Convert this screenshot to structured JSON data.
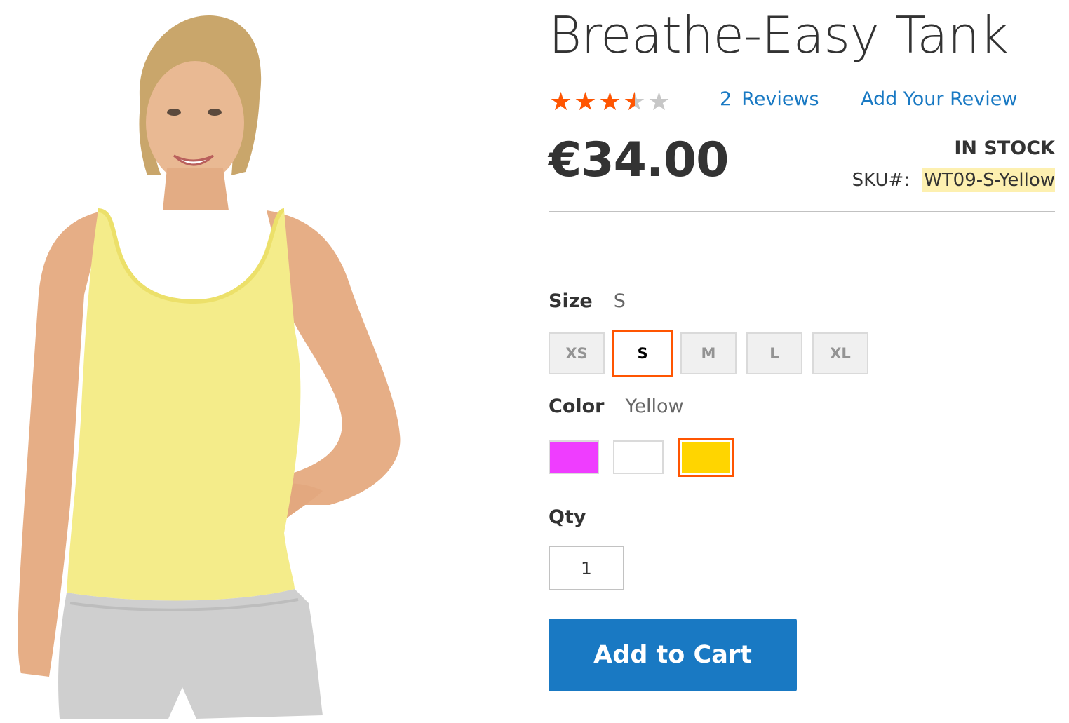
{
  "product": {
    "title": "Breathe-Easy Tank",
    "price": "€34.00",
    "stock_status": "IN STOCK",
    "sku_label": "SKU#:",
    "sku_value": "WT09-S-Yellow",
    "image_alt": "Woman wearing yellow tank top and gray shorts"
  },
  "rating": {
    "stars_filled_fraction": 0.7,
    "star_glyph": "★",
    "star_count": 5,
    "filled_color": "#ff5501",
    "empty_color": "#c7c7c7",
    "reviews_count": "2",
    "reviews_label": "Reviews",
    "add_review_label": "Add Your Review"
  },
  "options": {
    "size": {
      "label": "Size",
      "selected": "S",
      "values": [
        "XS",
        "S",
        "M",
        "L",
        "XL"
      ]
    },
    "color": {
      "label": "Color",
      "selected": "Yellow",
      "swatches": [
        {
          "name": "Purple",
          "hex": "#ef3dff"
        },
        {
          "name": "White",
          "hex": "#ffffff"
        },
        {
          "name": "Yellow",
          "hex": "#ffd500"
        }
      ]
    }
  },
  "qty": {
    "label": "Qty",
    "value": "1"
  },
  "actions": {
    "add_to_cart_label": "Add to Cart"
  },
  "colors": {
    "accent_link": "#1979c3",
    "selected_border": "#ff5501",
    "sku_highlight": "#fdf0b0"
  }
}
